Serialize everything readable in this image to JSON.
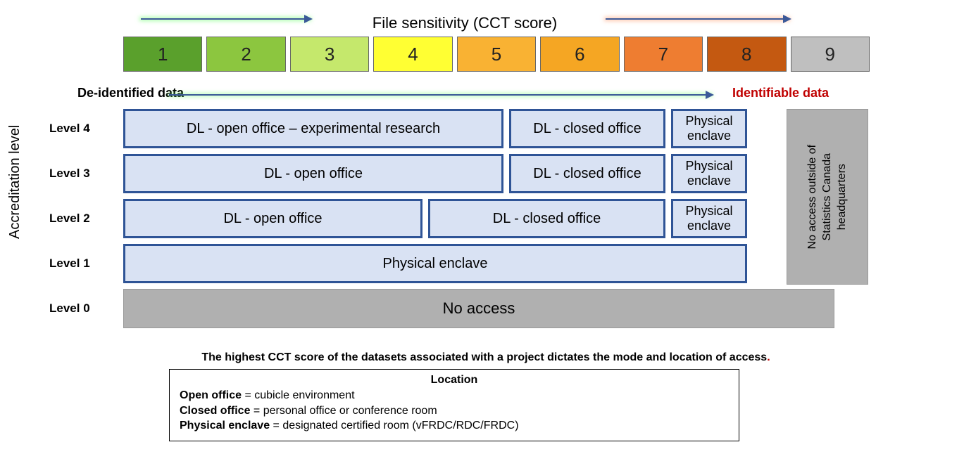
{
  "header": {
    "title": "File sensitivity (CCT score)"
  },
  "labels": {
    "deidentified": "De-identified data",
    "identifiable": "Identifiable data",
    "y_axis": "Accreditation level"
  },
  "scores": [
    {
      "n": "1",
      "color": "#5aa02c"
    },
    {
      "n": "2",
      "color": "#8cc63f"
    },
    {
      "n": "3",
      "color": "#c5e86c"
    },
    {
      "n": "4",
      "color": "#ffff33"
    },
    {
      "n": "5",
      "color": "#f9b233"
    },
    {
      "n": "6",
      "color": "#f5a623"
    },
    {
      "n": "7",
      "color": "#ee7d31"
    },
    {
      "n": "8",
      "color": "#c45911"
    },
    {
      "n": "9",
      "color": "#bfbfbf"
    }
  ],
  "vertical_noaccess": "No access outside of Statistics Canada headquarters",
  "levels": {
    "level4": {
      "label": "Level 4",
      "a": "DL - open office – experimental research",
      "b": "DL - closed office",
      "c": "Physical enclave"
    },
    "level3": {
      "label": "Level 3",
      "a": "DL - open office",
      "b": "DL - closed office",
      "c": "Physical enclave"
    },
    "level2": {
      "label": "Level 2",
      "a": "DL - open office",
      "b": "DL - closed office",
      "c": "Physical enclave"
    },
    "level1": {
      "label": "Level 1",
      "a": "Physical enclave"
    },
    "level0": {
      "label": "Level 0",
      "a": "No access"
    }
  },
  "footnote": "The highest CCT score of the datasets associated with a project dictates the mode and location of access",
  "legend": {
    "title": "Location",
    "open_k": "Open office",
    "open_v": " = cubicle environment",
    "closed_k": "Closed office",
    "closed_v": " = personal office or conference room",
    "enclave_k": "Physical enclave",
    "enclave_v": " = designated certified room (vFRDC/RDC/FRDC)"
  },
  "chart_data": {
    "type": "table",
    "title": "Access mode by accreditation level and CCT sensitivity score",
    "x_axis": "CCT score (file sensitivity)",
    "y_axis": "Accreditation level",
    "cct_scores": [
      1,
      2,
      3,
      4,
      5,
      6,
      7,
      8,
      9
    ],
    "score_category": {
      "1-8": "De-identified data",
      "9": "Identifiable data"
    },
    "matrix": {
      "Level 4": {
        "1-5": "DL - open office – experimental research",
        "6-7": "DL - closed office",
        "8": "Physical enclave",
        "9": "No access outside of Statistics Canada headquarters"
      },
      "Level 3": {
        "1-5": "DL - open office",
        "6-7": "DL - closed office",
        "8": "Physical enclave",
        "9": "No access outside of Statistics Canada headquarters"
      },
      "Level 2": {
        "1-4": "DL - open office",
        "5-7": "DL - closed office",
        "8": "Physical enclave",
        "9": "No access outside of Statistics Canada headquarters"
      },
      "Level 1": {
        "1-8": "Physical enclave",
        "9": "No access outside of Statistics Canada headquarters"
      },
      "Level 0": {
        "1-9": "No access"
      }
    }
  }
}
